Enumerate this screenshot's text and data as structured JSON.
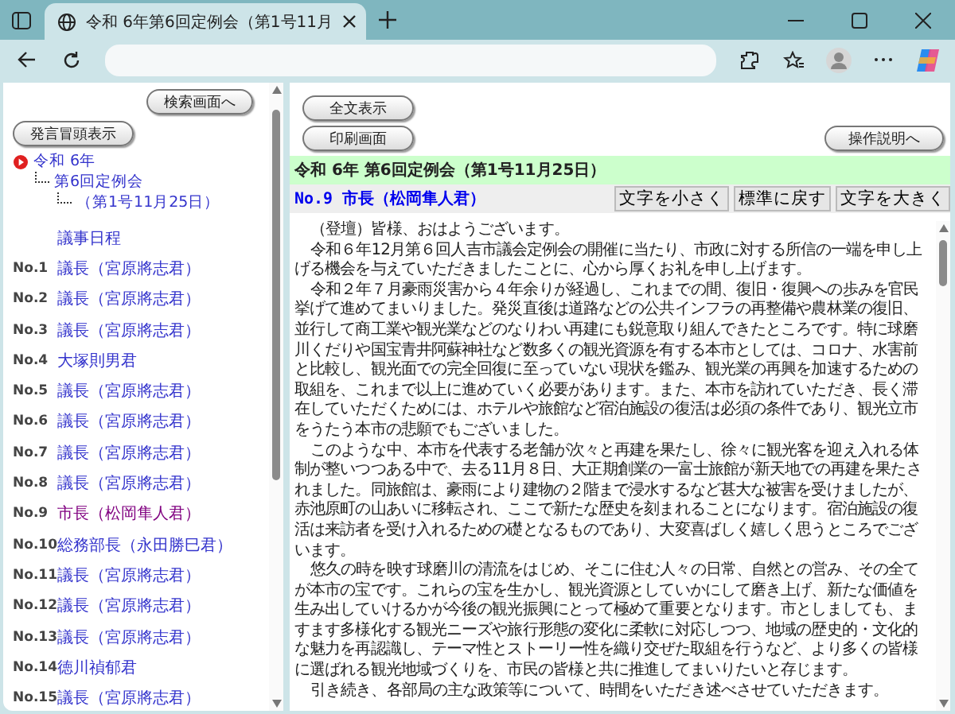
{
  "browser": {
    "tab_title": "令和 6年第6回定例会（第1号11月"
  },
  "sidebar": {
    "search_button": "検索画面へ",
    "toggle_button": "発言冒頭表示",
    "tree": [
      {
        "label": "令和 6年",
        "children": [
          {
            "label": "第6回定例会",
            "children": [
              {
                "label": "（第1号11月25日）"
              }
            ]
          }
        ]
      }
    ],
    "items": [
      {
        "label": "議事日程",
        "selected": false
      },
      {
        "number": "No.1",
        "label": "議長（宮原將志君）",
        "selected": false
      },
      {
        "number": "No.2",
        "label": "議長（宮原將志君）",
        "selected": false
      },
      {
        "number": "No.3",
        "label": "議長（宮原將志君）",
        "selected": false
      },
      {
        "number": "No.4",
        "label": "大塚則男君",
        "selected": false
      },
      {
        "number": "No.5",
        "label": "議長（宮原將志君）",
        "selected": false
      },
      {
        "number": "No.6",
        "label": "議長（宮原將志君）",
        "selected": false
      },
      {
        "number": "No.7",
        "label": "議長（宮原將志君）",
        "selected": false
      },
      {
        "number": "No.8",
        "label": "議長（宮原將志君）",
        "selected": false
      },
      {
        "number": "No.9",
        "label": "市長（松岡隼人君）",
        "selected": true
      },
      {
        "number": "No.10",
        "label": "総務部長（永田勝巳君）",
        "selected": false
      },
      {
        "number": "No.11",
        "label": "議長（宮原將志君）",
        "selected": false
      },
      {
        "number": "No.12",
        "label": "議長（宮原將志君）",
        "selected": false
      },
      {
        "number": "No.13",
        "label": "議長（宮原將志君）",
        "selected": false
      },
      {
        "number": "No.14",
        "label": "徳川禎郁君",
        "selected": false
      },
      {
        "number": "No.15",
        "label": "議長（宮原將志君）",
        "selected": false
      }
    ]
  },
  "content": {
    "buttons": [
      "全文表示",
      "印刷画面"
    ],
    "help_button": "操作説明へ",
    "session_title": "令和 6年 第6回定例会（第1号11月25日）",
    "speaker": "No.9 市長（松岡隼人君）",
    "font_buttons": [
      "文字を小さく",
      "標準に戻す",
      "文字を大きく"
    ],
    "paragraphs": [
      "（登壇）皆様、おはようございます。",
      "令和６年12月第６回人吉市議会定例会の開催に当たり、市政に対する所信の一端を申し上げる機会を与えていただきましたことに、心から厚くお礼を申し上げます。",
      "令和２年７月豪雨災害から４年余りが経過し、これまでの間、復旧・復興への歩みを官民挙げて進めてまいりました。発災直後は道路などの公共インフラの再整備や農林業の復旧、並行して商工業や観光業などのなりわい再建にも鋭意取り組んできたところです。特に球磨川くだりや国宝青井阿蘇神社など数多くの観光資源を有する本市としては、コロナ、水害前と比較し、観光面での完全回復に至っていない現状を鑑み、観光業の再興を加速するための取組を、これまで以上に進めていく必要があります。また、本市を訪れていただき、長く滞在していただくためには、ホテルや旅館など宿泊施設の復活は必須の条件であり、観光立市をうたう本市の悲願でもございました。",
      "このような中、本市を代表する老舗が次々と再建を果たし、徐々に観光客を迎え入れる体制が整いつつある中で、去る11月８日、大正期創業の一富士旅館が新天地での再建を果たされました。同旅館は、豪雨により建物の２階まで浸水するなど甚大な被害を受けましたが、赤池原町の山あいに移転され、ここで新たな歴史を刻まれることになります。宿泊施設の復活は来訪者を受け入れるための礎となるものであり、大変喜ばしく嬉しく思うところでございます。",
      "悠久の時を映す球磨川の清流をはじめ、そこに住む人々の日常、自然との営み、その全てが本市の宝です。これらの宝を生かし、観光資源としていかにして磨き上げ、新たな価値を生み出していけるかが今後の観光振興にとって極めて重要となります。市としましても、ますます多様化する観光ニーズや旅行形態の変化に柔軟に対応しつつ、地域の歴史的・文化的な魅力を再認識し、テーマ性とストーリー性を織り交ぜた取組を行うなど、より多くの皆様に選ばれる観光地域づくりを、市民の皆様と共に推進してまいりたいと存じます。",
      "引き続き、各部局の主な政策等について、時間をいただき述べさせていただきます。"
    ]
  }
}
